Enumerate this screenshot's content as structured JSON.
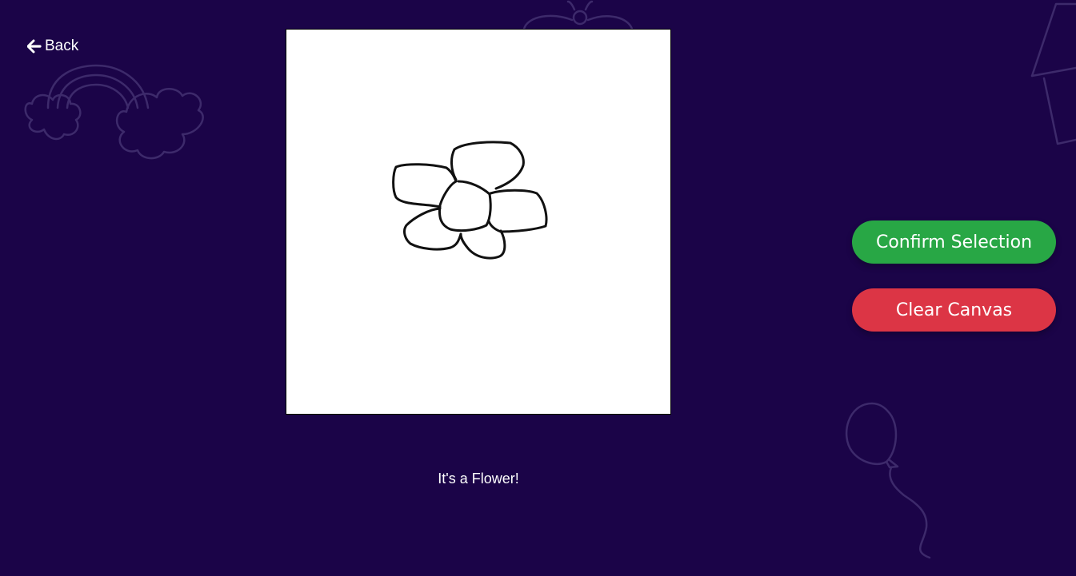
{
  "nav": {
    "back_label": "Back",
    "back_icon": "arrow-left-icon"
  },
  "canvas": {
    "background": "#ffffff",
    "stroke_color": "#111111"
  },
  "prediction": {
    "text": "It's a Flower!"
  },
  "actions": {
    "confirm_label": "Confirm Selection",
    "clear_label": "Clear Canvas"
  },
  "colors": {
    "background": "#1b0448",
    "doodle": "#3d2a6b",
    "confirm": "#28a745",
    "clear": "#dc3545",
    "text": "#ffffff"
  },
  "decorations": [
    "rainbow-cloud-doodle",
    "butterfly-doodle",
    "house-doodle",
    "balloon-doodle"
  ]
}
